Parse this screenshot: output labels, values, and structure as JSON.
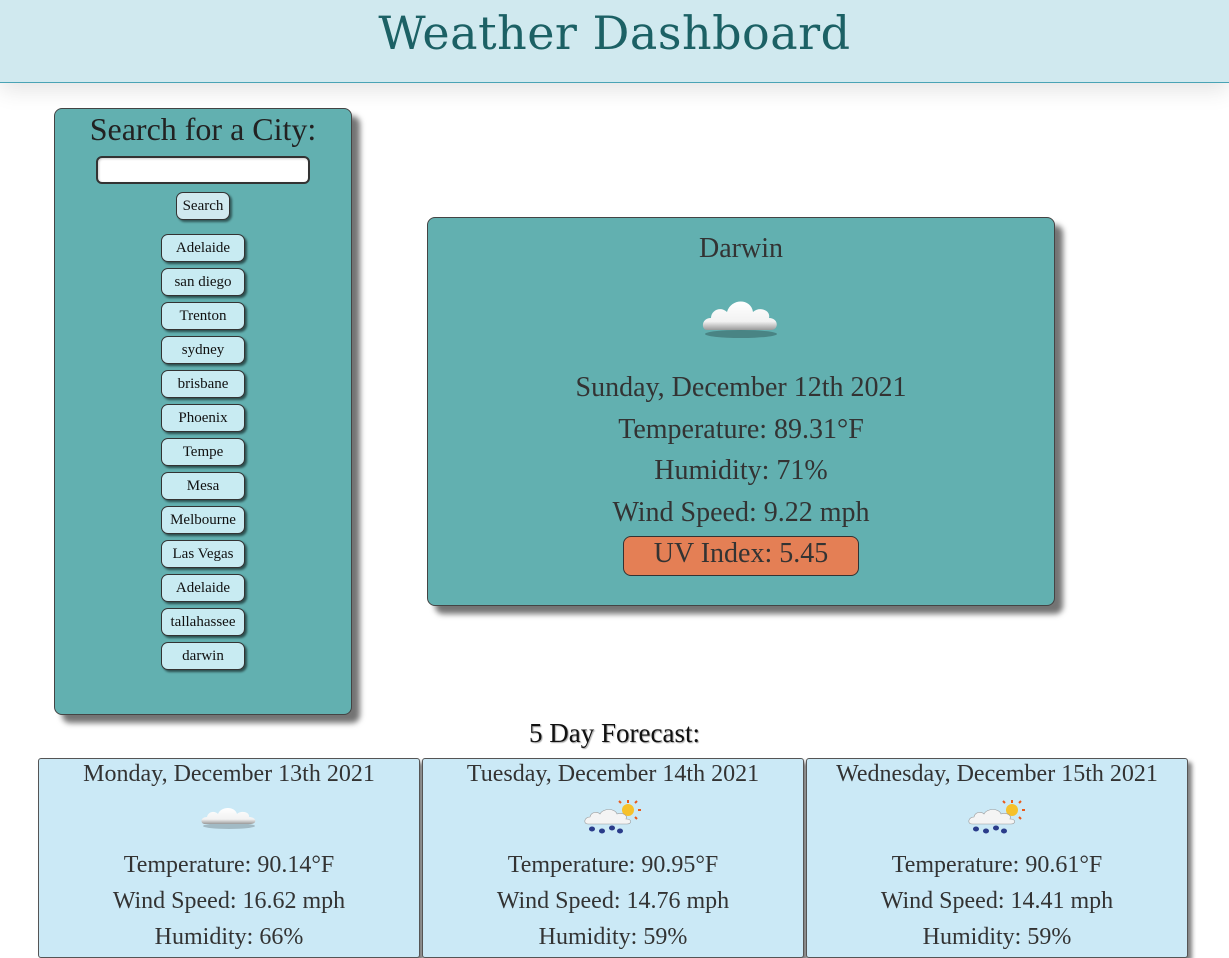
{
  "header": {
    "title": "Weather Dashboard"
  },
  "sidebar": {
    "title": "Search for a City:",
    "search_value": "",
    "search_label": "Search",
    "history": [
      "Adelaide",
      "san diego",
      "Trenton",
      "sydney",
      "brisbane",
      "Phoenix",
      "Tempe",
      "Mesa",
      "Melbourne",
      "Las Vegas",
      "Adelaide",
      "tallahassee",
      "darwin"
    ]
  },
  "current": {
    "city": "Darwin",
    "icon": "cloud-icon",
    "date": "Sunday, December 12th 2021",
    "temperature": "Temperature: 89.31°F",
    "humidity": "Humidity: 71%",
    "wind": "Wind Speed: 9.22 mph",
    "uv": "UV Index: 5.45",
    "uv_color": "#e47f55"
  },
  "forecast": {
    "title": "5 Day Forecast:",
    "days": [
      {
        "date": "Monday, December 13th 2021",
        "icon": "cloud-icon",
        "temperature": "Temperature: 90.14°F",
        "wind": "Wind Speed: 16.62 mph",
        "humidity": "Humidity: 66%"
      },
      {
        "date": "Tuesday, December 14th 2021",
        "icon": "rain-sun-icon",
        "temperature": "Temperature: 90.95°F",
        "wind": "Wind Speed: 14.76 mph",
        "humidity": "Humidity: 59%"
      },
      {
        "date": "Wednesday, December 15th 2021",
        "icon": "rain-sun-icon",
        "temperature": "Temperature: 90.61°F",
        "wind": "Wind Speed: 14.41 mph",
        "humidity": "Humidity: 59%"
      }
    ]
  },
  "colors": {
    "header_bg": "#d0e9ef",
    "panel_bg": "#62b0b0",
    "forecast_card_bg": "#cbe9f6",
    "title_color": "#1c6165"
  }
}
